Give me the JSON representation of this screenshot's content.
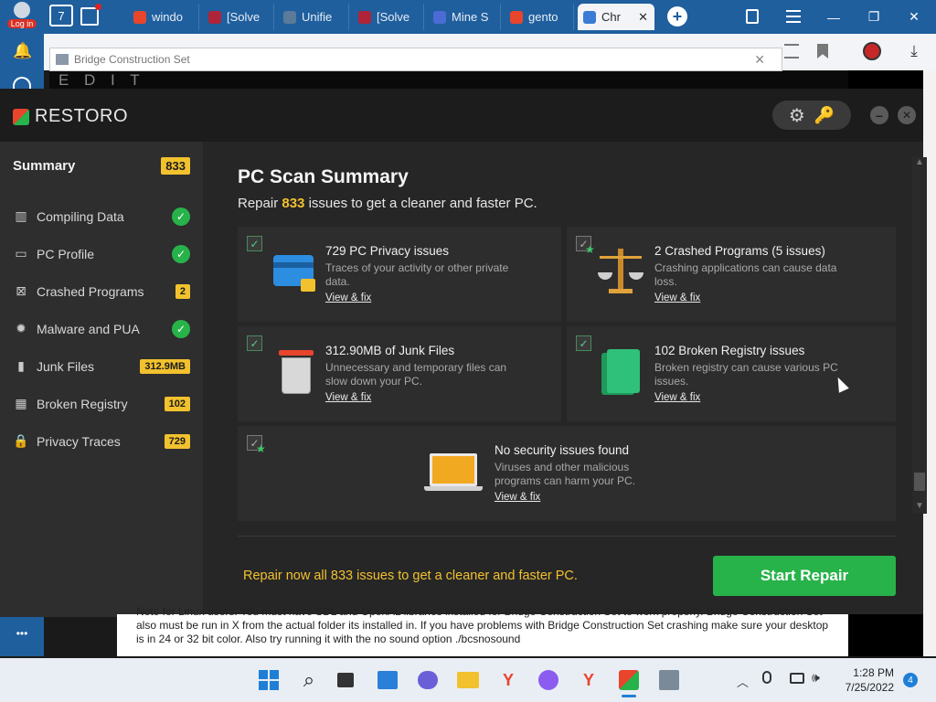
{
  "browser": {
    "login_label": "Log in",
    "tabs": [
      {
        "label": "windo",
        "color": "#e8452c"
      },
      {
        "label": "[Solve",
        "color": "#b0243a"
      },
      {
        "label": "Unifie",
        "color": "#5c7a99"
      },
      {
        "label": "[Solve",
        "color": "#b0243a"
      },
      {
        "label": "Mine S",
        "color": "#4a6cd4"
      },
      {
        "label": "gento",
        "color": "#e8452c"
      },
      {
        "label": "Chr",
        "color": "#3a7bd5"
      }
    ],
    "tab_count": "7",
    "close_tab_glyph": "✕",
    "new_tab_glyph": "+",
    "window_controls": [
      "—",
      "❐",
      "✕"
    ]
  },
  "bridge_window": {
    "title": "Bridge Construction Set",
    "partial_heading": "E D I T"
  },
  "restoro": {
    "brand": "RESTORO",
    "summary": {
      "label": "Summary",
      "count": "833"
    },
    "sidebar": [
      {
        "label": "Compiling Data",
        "status": "ok",
        "icon": "bar-chart-icon"
      },
      {
        "label": "PC Profile",
        "status": "ok",
        "icon": "monitor-icon"
      },
      {
        "label": "Crashed Programs",
        "badge": "2",
        "icon": "crashed-program-icon"
      },
      {
        "label": "Malware and PUA",
        "status": "ok",
        "icon": "bug-icon"
      },
      {
        "label": "Junk Files",
        "badge": "312.9MB",
        "icon": "trash-icon"
      },
      {
        "label": "Broken Registry",
        "badge": "102",
        "icon": "registry-icon"
      },
      {
        "label": "Privacy Traces",
        "badge": "729",
        "icon": "lock-icon"
      }
    ],
    "heading": "PC Scan Summary",
    "subheading": {
      "before": "Repair",
      "count": "833",
      "after": "issues to get a cleaner and faster PC."
    },
    "cards": {
      "privacy": {
        "title": "729 PC Privacy issues",
        "desc": "Traces of your activity or other private data.",
        "link": "View & fix"
      },
      "crashed": {
        "title": "2 Crashed Programs (5 issues)",
        "desc": "Crashing applications can cause data loss.",
        "link": "View & fix"
      },
      "junk": {
        "title": "312.90MB of Junk Files",
        "desc": "Unnecessary and temporary files can slow down your PC.",
        "link": "View & fix"
      },
      "registry": {
        "title": "102 Broken Registry issues",
        "desc": "Broken registry can cause various PC issues.",
        "link": "View & fix"
      },
      "security": {
        "title": "No security issues found",
        "desc": "Viruses and other malicious programs can harm your PC.",
        "link": "View & fix"
      }
    },
    "footer_text": "Repair now all 833 issues to get a cleaner and faster PC.",
    "start_button": "Start Repair",
    "accent": "#f2c12e",
    "green": "#27b34a"
  },
  "webpage": {
    "text": "Note for Linux users: You must have SDL and OpenAL libraries installed for Bridge Construction Set to work properly. Bridge Construction Set also must be run in X from the actual folder its installed in. If you have problems with Bridge Construction Set crashing make sure your desktop is in 24 or 32 bit color. Also try running it with the no sound option ./bcsnosound"
  },
  "taskbar": {
    "time": "1:28 PM",
    "date": "7/25/2022",
    "notification_count": "4",
    "more_glyph": "•••"
  }
}
